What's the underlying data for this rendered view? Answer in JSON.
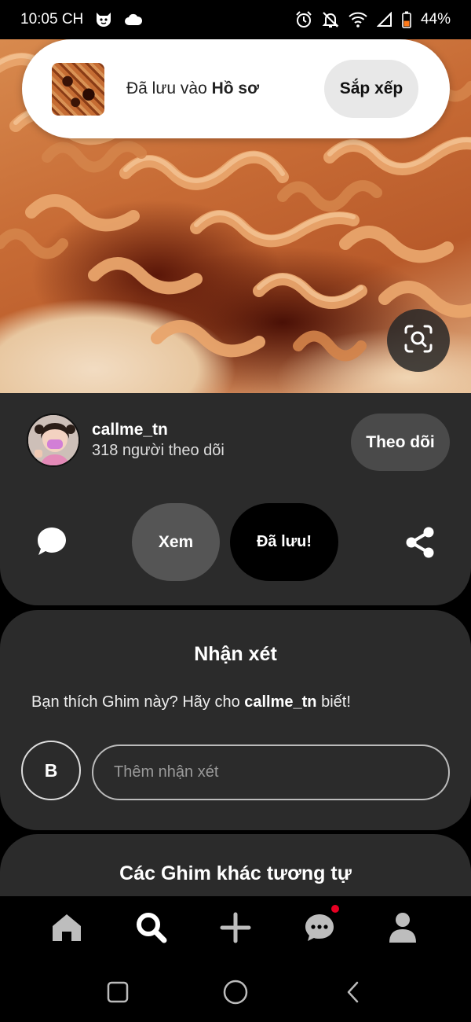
{
  "status_bar": {
    "time": "10:05 CH",
    "battery": "44%",
    "icons": [
      "face-icon",
      "cloud-icon",
      "alarm-icon",
      "mute-icon",
      "wifi-icon",
      "signal-icon",
      "battery-icon"
    ]
  },
  "toast": {
    "text_prefix": "Đã lưu vào ",
    "text_target": "Hồ sơ",
    "action_label": "Sắp xếp"
  },
  "pin": {
    "author_name": "callme_tn",
    "followers": "318 người theo dõi",
    "follow_label": "Theo dõi",
    "view_label": "Xem",
    "saved_label": "Đã lưu!"
  },
  "comments": {
    "title": "Nhận xét",
    "prompt_prefix": "Bạn thích Ghim này? Hãy cho ",
    "prompt_name": "callme_tn",
    "prompt_suffix": " biết!",
    "user_initial": "B",
    "placeholder": "Thêm nhận xét"
  },
  "similar": {
    "title": "Các Ghim khác tương tự"
  },
  "bottom_nav": {
    "items": [
      "home-icon",
      "search-icon",
      "add-icon",
      "messages-icon",
      "profile-icon"
    ],
    "active": "search-icon",
    "notification_color": "#e60023"
  },
  "system_nav": [
    "recents-icon",
    "home-circle-icon",
    "back-icon"
  ]
}
